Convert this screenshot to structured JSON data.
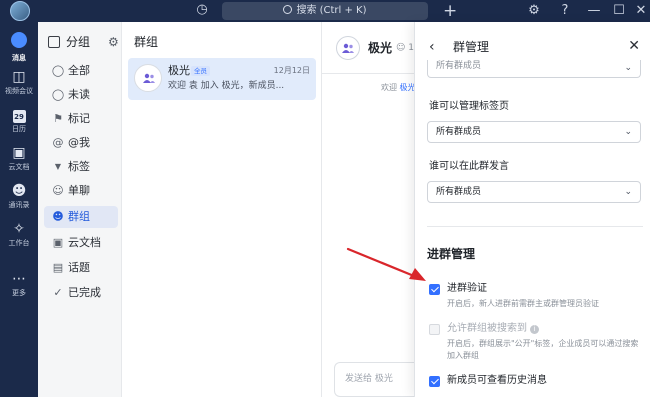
{
  "titlebar": {
    "search_placeholder": "搜索 (Ctrl + K)"
  },
  "rail": {
    "items": [
      {
        "label": "消息",
        "icon": "chat-bubble-icon"
      },
      {
        "label": "视频会议",
        "icon": "video-camera-icon"
      },
      {
        "label": "日历",
        "icon": "calendar-icon"
      },
      {
        "label": "云文档",
        "icon": "document-icon"
      },
      {
        "label": "通讯录",
        "icon": "contacts-icon"
      },
      {
        "label": "工作台",
        "icon": "grid-icon"
      },
      {
        "label": "更多",
        "icon": "more-dots-icon"
      }
    ],
    "calendar_day": "29"
  },
  "groups": {
    "title": "分组",
    "items": [
      {
        "label": "全部",
        "icon": "chat-icon"
      },
      {
        "label": "未读",
        "icon": "unread-icon"
      },
      {
        "label": "标记",
        "icon": "flag-icon"
      },
      {
        "label": "@我",
        "icon": "at-icon"
      },
      {
        "label": "标签",
        "icon": "caret-down-icon"
      },
      {
        "label": "单聊",
        "icon": "person-icon"
      },
      {
        "label": "群组",
        "icon": "group-icon"
      },
      {
        "label": "云文档",
        "icon": "doc-icon"
      },
      {
        "label": "话题",
        "icon": "topic-icon"
      },
      {
        "label": "已完成",
        "icon": "check-circle-icon"
      }
    ]
  },
  "chatlist": {
    "title": "群组",
    "chat": {
      "name": "极光",
      "badge": "全员",
      "date": "12月12日",
      "preview": "欢迎 袁 加入 极光，新成员..."
    }
  },
  "chat": {
    "name": "极光",
    "member_count": "1",
    "system_prefix": "欢迎",
    "system_link": "极光",
    "input_placeholder": "发送给 极光"
  },
  "panel": {
    "title": "群管理",
    "top_select_value": "所有群成员",
    "tab_admin_label": "谁可以管理标签页",
    "tab_admin_value": "所有群成员",
    "speak_label": "谁可以在此群发言",
    "speak_value": "所有群成员",
    "section_title": "进群管理",
    "verify_label": "进群验证",
    "verify_desc": "开启后，新人进群前需群主或群管理员验证",
    "searchable_label": "允许群组被搜索到",
    "searchable_desc": "开启后，群组展示\"公开\"标签，企业成员可以通过搜索加入群组",
    "history_label": "新成员可查看历史消息"
  },
  "colors": {
    "rail_bg": "#1b2a4a",
    "accent": "#3370ff",
    "annotation_arrow": "#d9262b"
  }
}
